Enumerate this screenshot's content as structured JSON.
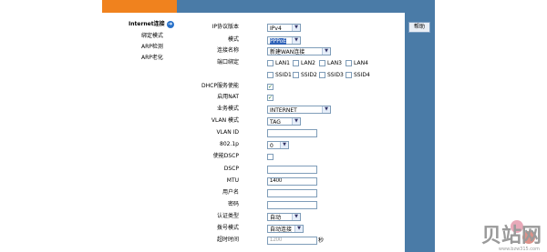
{
  "sidebar": {
    "items": [
      {
        "label": "Internet连接",
        "active": true
      },
      {
        "label": "绑定模式"
      },
      {
        "label": "ARP检测"
      },
      {
        "label": "ARP老化"
      }
    ]
  },
  "help_button": "帮助",
  "form": {
    "ip_version": {
      "label": "IP协议版本",
      "value": "IPv4"
    },
    "mode": {
      "label": "模式",
      "value": "PPPoE"
    },
    "conn_name": {
      "label": "连接名称",
      "value": "新建WAN连接"
    },
    "port_bind": {
      "label": "端口绑定",
      "options": [
        "LAN1",
        "LAN2",
        "LAN3",
        "LAN4",
        "SSID1",
        "SSID2",
        "SSID3",
        "SSID4"
      ]
    },
    "dhcp": {
      "label": "DHCP服务使能",
      "checked": true
    },
    "nat": {
      "label": "启用NAT",
      "checked": true
    },
    "service_mode": {
      "label": "业务模式",
      "value": "INTERNET"
    },
    "vlan_mode": {
      "label": "VLAN 模式",
      "value": "TAG"
    },
    "vlan_id": {
      "label": "VLAN ID",
      "value": ""
    },
    "dot1p": {
      "label": "802.1p",
      "value": "0"
    },
    "dscp_enable": {
      "label": "使能DSCP",
      "checked": false
    },
    "dscp": {
      "label": "DSCP",
      "value": ""
    },
    "mtu": {
      "label": "MTU",
      "value": "1400"
    },
    "username": {
      "label": "用户名",
      "value": ""
    },
    "password": {
      "label": "密码",
      "value": ""
    },
    "auth_type": {
      "label": "认证类型",
      "value": "自动"
    },
    "dial_mode": {
      "label": "拨号模式",
      "value": "自动连接"
    },
    "idle_timeout": {
      "label": "超时时间",
      "value": "1200",
      "unit": "秒"
    }
  },
  "watermark": {
    "main": "贝站网",
    "sub": "www.bzw315.com"
  },
  "colors": {
    "orange": "#f0821e",
    "blue": "#4a7ba7"
  }
}
